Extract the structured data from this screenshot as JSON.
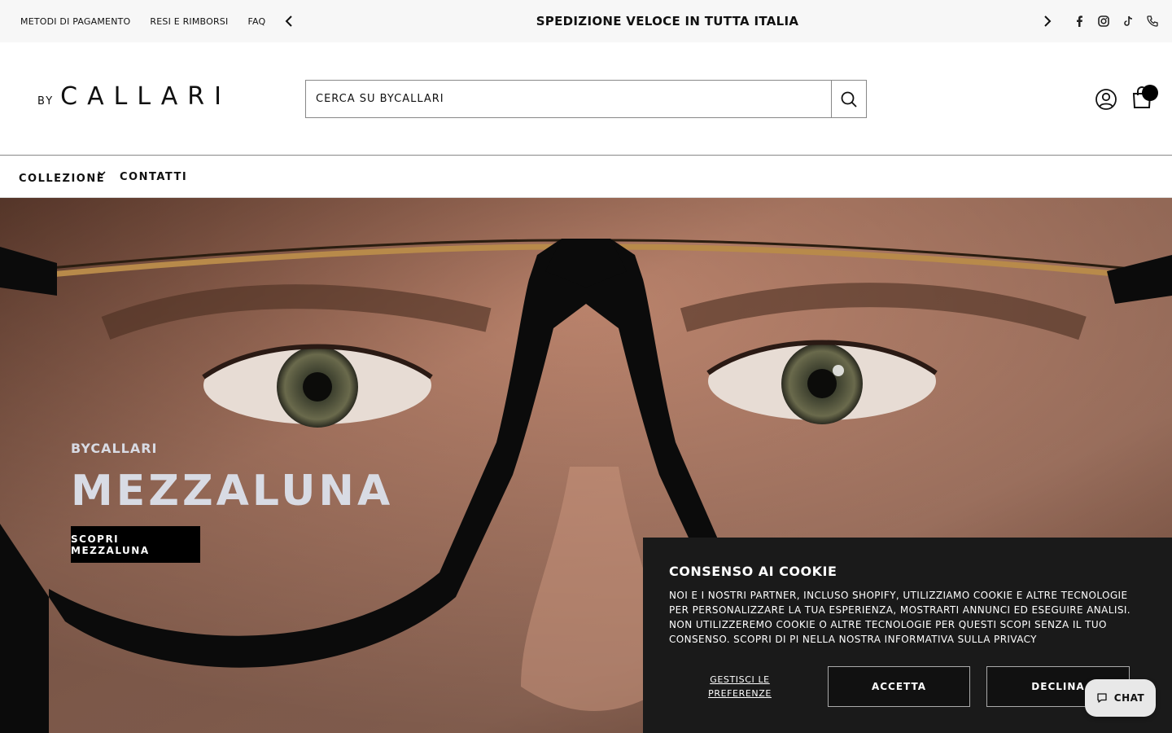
{
  "topbar": {
    "links": [
      "Metodi di pagamento",
      "Resi e rimborsi",
      "FAQ"
    ],
    "announcement": "SPEDIZIONE VELOCE IN TUTTA ITALIA",
    "social_icons": [
      "facebook-icon",
      "instagram-icon",
      "tiktok-icon",
      "phone-icon"
    ]
  },
  "header": {
    "logo_by": "BY",
    "logo_name": "CALLARI",
    "search_placeholder": "CERCA SU BYCALLARI"
  },
  "nav": {
    "items": [
      "COLLEZIONE",
      "CONTATTI"
    ]
  },
  "hero": {
    "brand": "BYCALLARI",
    "title": "MEZZALUNA",
    "cta": "SCOPRI MEZZALUNA"
  },
  "cookie": {
    "title": "CONSENSO AI COOKIE",
    "text": "Noi e i nostri partner, incluso Shopify, utilizziamo cookie e altre tecnologie per personalizzare la tua esperienza, mostrarti annunci ed eseguire analisi. Non utilizzeremo cookie o altre tecnologie per questi scopi senza il tuo consenso. Scopri di pi nella nostra",
    "privacy_link": "Informativa sulla privacy",
    "manage": "Gestisci le preferenze",
    "accept": "ACCETTA",
    "decline": "DECLINA"
  },
  "chat": {
    "label": "CHAT"
  },
  "colors": {
    "topbar_bg": "#f7f7f7",
    "cookie_bg": "#1a1a1a",
    "accent": "#000000",
    "hero_text": "#d8dbe4"
  }
}
